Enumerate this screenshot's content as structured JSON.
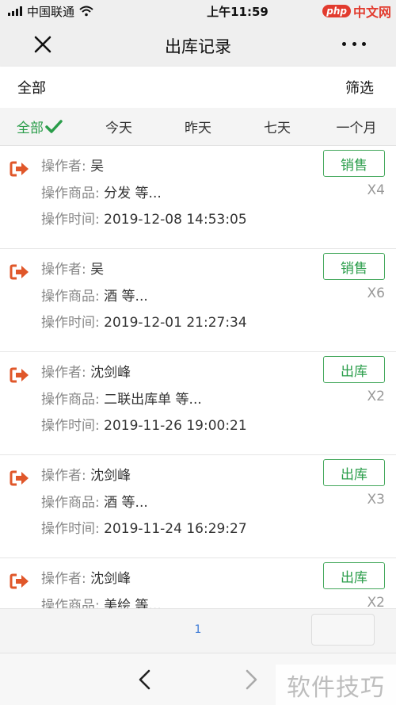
{
  "status_bar": {
    "carrier": "中国联通",
    "time": "上午11:59",
    "site_badge": "php",
    "site_text": "中文网"
  },
  "header": {
    "title": "出库记录"
  },
  "filter_bar": {
    "left_label": "全部",
    "right_label": "筛选"
  },
  "date_tabs": [
    {
      "label": "全部",
      "active": true
    },
    {
      "label": "今天",
      "active": false
    },
    {
      "label": "昨天",
      "active": false
    },
    {
      "label": "七天",
      "active": false
    },
    {
      "label": "一个月",
      "active": false
    }
  ],
  "labels": {
    "operator": "操作者:",
    "goods": "操作商品:",
    "time": "操作时间:"
  },
  "records": [
    {
      "operator": "吴",
      "goods": "分发 等...",
      "time": "2019-12-08 14:53:05",
      "type": "销售",
      "qty": "X4"
    },
    {
      "operator": "吴",
      "goods": "酒 等...",
      "time": "2019-12-01 21:27:34",
      "type": "销售",
      "qty": "X6"
    },
    {
      "operator": "沈剑峰",
      "goods": "二联出库单 等...",
      "time": "2019-11-26 19:00:21",
      "type": "出库",
      "qty": "X2"
    },
    {
      "operator": "沈剑峰",
      "goods": "酒 等...",
      "time": "2019-11-24 16:29:27",
      "type": "出库",
      "qty": "X3"
    },
    {
      "operator": "沈剑峰",
      "goods": "美绘 等...",
      "time": "",
      "type": "出库",
      "qty": "X2"
    }
  ],
  "pager": {
    "page": "1"
  },
  "watermark": "软件技巧",
  "colors": {
    "accent_green": "#2a9d4a",
    "icon_orange": "#e0572a",
    "link_blue": "#3d7bd6"
  }
}
